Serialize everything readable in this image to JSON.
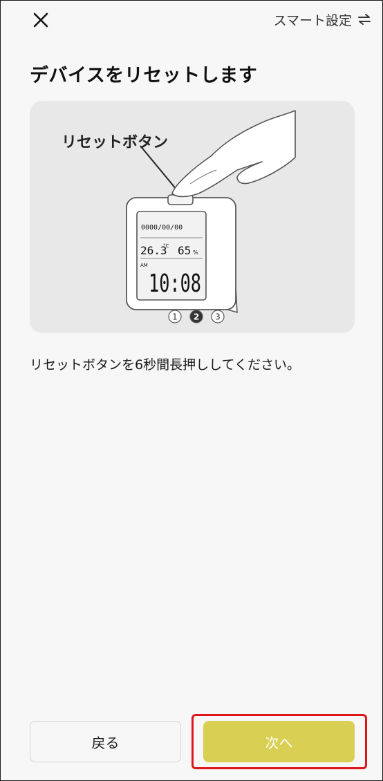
{
  "header": {
    "close_icon": "close-icon",
    "smart_setup_label": "スマート設定",
    "swap_icon": "swap-arrows-icon"
  },
  "page": {
    "title": "デバイスをリセットします",
    "instruction": "リセットボタンを6秒間長押ししてください。"
  },
  "illustration": {
    "callout_label": "リセットボタン",
    "lcd": {
      "date": "0000/00/00",
      "temperature": "26.3",
      "temperature_unit": "°C",
      "humidity": "65",
      "humidity_unit": "%",
      "ampm": "AM",
      "time": "10:08"
    },
    "steps": [
      "1",
      "2",
      "3"
    ],
    "current_step": 2
  },
  "footer": {
    "back_label": "戻る",
    "next_label": "次へ"
  },
  "colors": {
    "accent": "#d9cf52",
    "highlight": "#e0141b",
    "background": "#f7f7f7"
  }
}
